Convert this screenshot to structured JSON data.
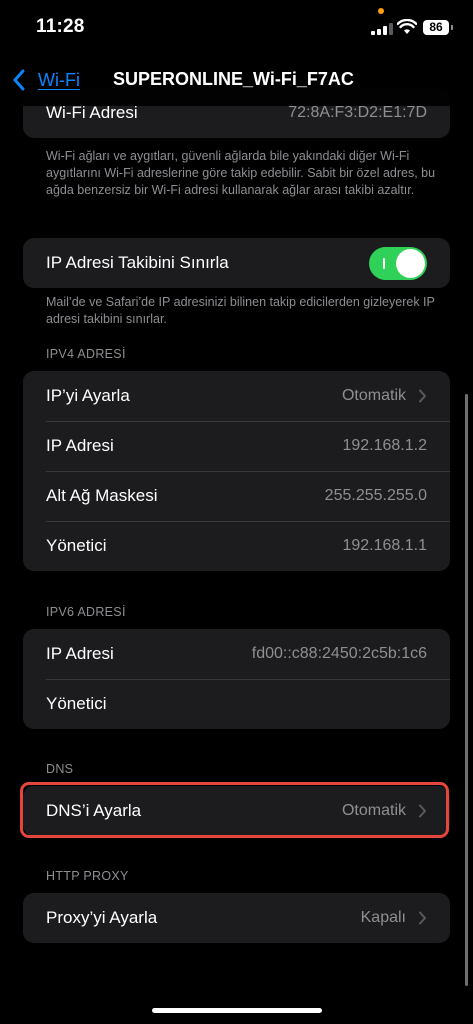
{
  "status_bar": {
    "time": "11:28",
    "battery_level": "86"
  },
  "nav": {
    "back_label": "Wi-Fi",
    "title": "SUPERONLINE_Wi-Fi_F7AC"
  },
  "wifi_address": {
    "label": "Wi-Fi Adresi",
    "value": "72:8A:F3:D2:E1:7D",
    "footer": "Wi-Fi ağları ve aygıtları, güvenli ağlarda bile yakındaki diğer Wi-Fi aygıtlarını Wi-Fi adreslerine göre takip edebilir. Sabit bir özel adres, bu ağda benzersiz bir Wi-Fi adresi kullanarak ağlar arası takibi azaltır."
  },
  "ip_tracking": {
    "label": "IP Adresi Takibini Sınırla",
    "enabled": true,
    "footer": "Mail’de ve Safari’de IP adresinizi bilinen takip edicilerden gizleyerek IP adresi takibini sınırlar."
  },
  "ipv4": {
    "header": "IPV4 ADRESİ",
    "rows": [
      {
        "label": "IP’yi Ayarla",
        "value": "Otomatik"
      },
      {
        "label": "IP Adresi",
        "value": "192.168.1.2"
      },
      {
        "label": "Alt Ağ Maskesi",
        "value": "255.255.255.0"
      },
      {
        "label": "Yönetici",
        "value": "192.168.1.1"
      }
    ]
  },
  "ipv6": {
    "header": "IPV6 ADRESİ",
    "rows": [
      {
        "label": "IP Adresi",
        "value": "fd00::c88:2450:2c5b:1c6"
      },
      {
        "label": "Yönetici",
        "value": ""
      }
    ]
  },
  "dns": {
    "header": "DNS",
    "label": "DNS’i Ayarla",
    "value": "Otomatik"
  },
  "proxy": {
    "header": "HTTP PROXY",
    "label": "Proxy’yi Ayarla",
    "value": "Kapalı"
  },
  "colors": {
    "accent": "#0a84ff",
    "toggle_on": "#30d158",
    "highlight": "#e5453a",
    "cell_background": "#1c1c1e"
  },
  "icons": [
    "chevron-left-icon",
    "chevron-right-icon",
    "signal-icon",
    "wifi-icon",
    "battery-icon"
  ]
}
